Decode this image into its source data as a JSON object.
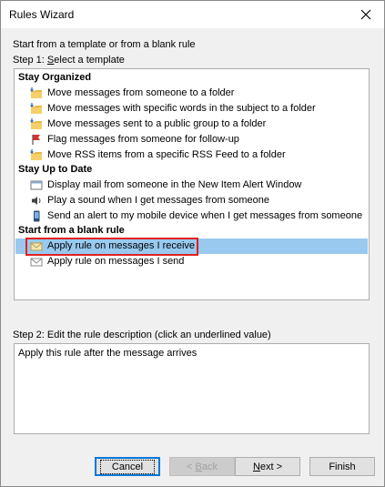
{
  "window": {
    "title": "Rules Wizard"
  },
  "intro": "Start from a template or from a blank rule",
  "step1": {
    "prefix": "Step 1: ",
    "mnemonic": "S",
    "rest": "elect a template"
  },
  "groups": [
    {
      "label": "Stay Organized",
      "items": [
        {
          "label": "Move messages from someone to a folder",
          "icon": "folder-arrow-icon"
        },
        {
          "label": "Move messages with specific words in the subject to a folder",
          "icon": "folder-arrow-icon"
        },
        {
          "label": "Move messages sent to a public group to a folder",
          "icon": "folder-arrow-icon"
        },
        {
          "label": "Flag messages from someone for follow-up",
          "icon": "red-flag-icon"
        },
        {
          "label": "Move RSS items from a specific RSS Feed to a folder",
          "icon": "folder-arrow-icon"
        }
      ]
    },
    {
      "label": "Stay Up to Date",
      "items": [
        {
          "label": "Display mail from someone in the New Item Alert Window",
          "icon": "alert-window-icon"
        },
        {
          "label": "Play a sound when I get messages from someone",
          "icon": "speaker-icon"
        },
        {
          "label": "Send an alert to my mobile device when I get messages from someone",
          "icon": "mobile-device-icon"
        }
      ]
    },
    {
      "label": "Start from a blank rule",
      "items": [
        {
          "label": "Apply rule on messages I receive",
          "icon": "envelope-receive-icon",
          "selected": true
        },
        {
          "label": "Apply rule on messages I send",
          "icon": "envelope-send-icon"
        }
      ]
    }
  ],
  "step2": {
    "label": "Step 2: Edit the rule description (click an underlined value)"
  },
  "description": "Apply this rule after the message arrives",
  "buttons": {
    "cancel": "Cancel",
    "back": {
      "prefix": "< ",
      "mnemonic": "B",
      "rest": "ack"
    },
    "next": {
      "mnemonic": "N",
      "rest": "ext >"
    },
    "finish": "Finish"
  },
  "colors": {
    "selection": "#99c9ef",
    "highlight_border": "#e02020",
    "default_button": "#0078d7"
  }
}
